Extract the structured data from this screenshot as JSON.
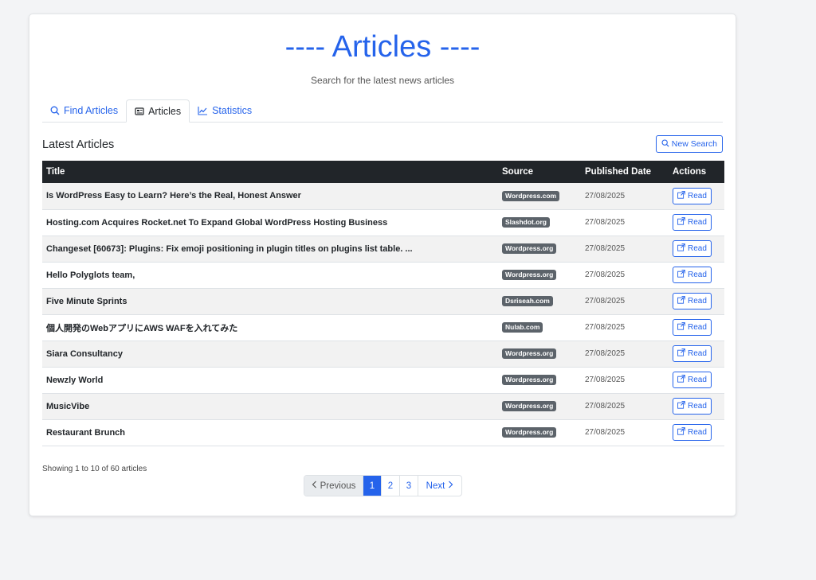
{
  "header": {
    "title": "---- Articles ----",
    "subtitle": "Search for the latest news articles"
  },
  "tabs": [
    {
      "label": "Find Articles",
      "icon": "search-icon",
      "active": false
    },
    {
      "label": "Articles",
      "icon": "newspaper-icon",
      "active": true
    },
    {
      "label": "Statistics",
      "icon": "chart-line-icon",
      "active": false
    }
  ],
  "section": {
    "title": "Latest Articles",
    "new_search_label": "New Search"
  },
  "table": {
    "columns": [
      "Title",
      "Source",
      "Published Date",
      "Actions"
    ],
    "read_label": "Read",
    "rows": [
      {
        "title": "Is WordPress Easy to Learn? Here’s the Real, Honest Answer",
        "source": "Wordpress.com",
        "date": "27/08/2025"
      },
      {
        "title": "Hosting.com Acquires Rocket.net To Expand Global WordPress Hosting Business",
        "source": "Slashdot.org",
        "date": "27/08/2025"
      },
      {
        "title": "Changeset [60673]: Plugins: Fix emoji positioning in plugin titles on plugins list table. ...",
        "source": "Wordpress.org",
        "date": "27/08/2025"
      },
      {
        "title": "Hello Polyglots team,",
        "source": "Wordpress.org",
        "date": "27/08/2025"
      },
      {
        "title": "Five Minute Sprints",
        "source": "Dsriseah.com",
        "date": "27/08/2025"
      },
      {
        "title": "個人開発のWebアプリにAWS WAFを入れてみた",
        "source": "Nulab.com",
        "date": "27/08/2025"
      },
      {
        "title": "Siara Consultancy",
        "source": "Wordpress.org",
        "date": "27/08/2025"
      },
      {
        "title": "Newzly World",
        "source": "Wordpress.org",
        "date": "27/08/2025"
      },
      {
        "title": "MusicVibe",
        "source": "Wordpress.org",
        "date": "27/08/2025"
      },
      {
        "title": "Restaurant Brunch",
        "source": "Wordpress.org",
        "date": "27/08/2025"
      }
    ]
  },
  "footer": {
    "showing": "Showing 1 to 10 of 60 articles"
  },
  "pagination": {
    "previous": "Previous",
    "pages": [
      "1",
      "2",
      "3"
    ],
    "current": "1",
    "next": "Next"
  },
  "colors": {
    "accent": "#2563eb",
    "header_bg": "#212529",
    "badge_bg": "#5c636a"
  }
}
